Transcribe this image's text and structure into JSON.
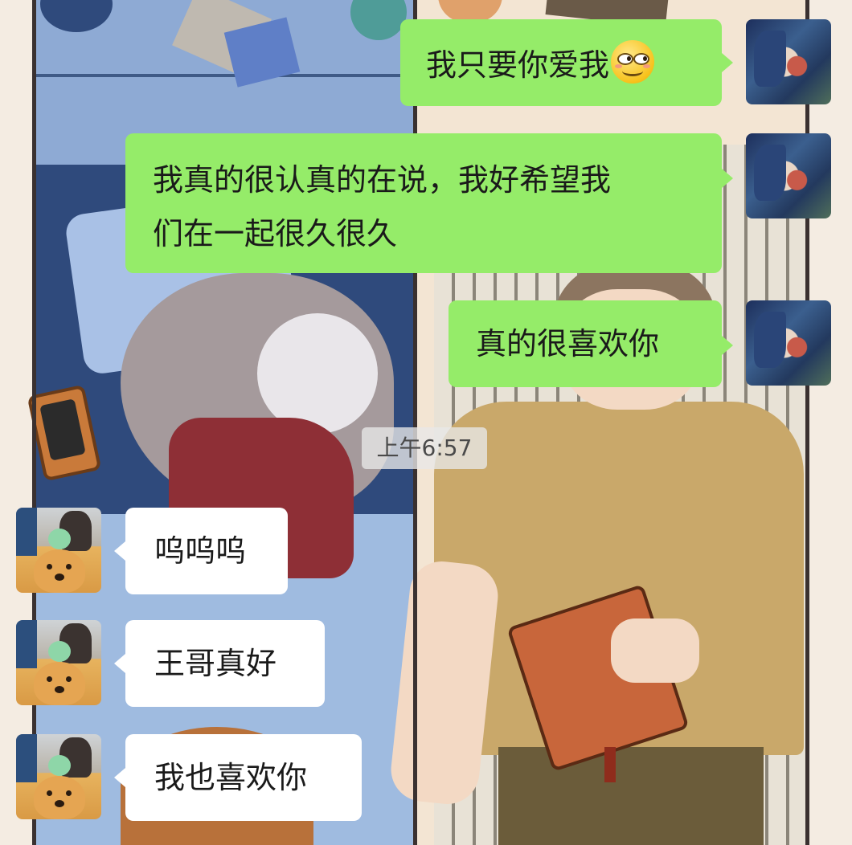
{
  "chat": {
    "messages": [
      {
        "id": 1,
        "side": "out",
        "sender": "self",
        "text": "我只要你爱我",
        "emoji": "smirk-eyes-emoji"
      },
      {
        "id": 2,
        "side": "out",
        "sender": "self",
        "lines": [
          "我真的很认真的在说，我好希望我",
          "们在一起很久很久"
        ]
      },
      {
        "id": 3,
        "side": "out",
        "sender": "self",
        "text": "真的很喜欢你"
      },
      {
        "id": 4,
        "side": "in",
        "sender": "other",
        "text": "呜呜呜"
      },
      {
        "id": 5,
        "side": "in",
        "sender": "other",
        "text": "王哥真好"
      },
      {
        "id": 6,
        "side": "in",
        "sender": "other",
        "text": "我也喜欢你"
      }
    ],
    "timestamp": "上午6:57"
  },
  "colors": {
    "outgoing_bubble": "#95ec69",
    "incoming_bubble": "#ffffff",
    "timestamp_bg": "#e8e8e8",
    "text": "#1a1a1a"
  }
}
